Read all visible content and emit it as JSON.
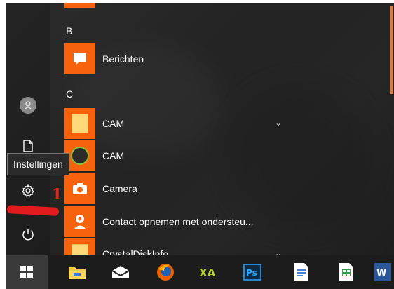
{
  "start_menu": {
    "tooltip": "Instellingen",
    "annotation_number": "1",
    "sections": [
      {
        "letter": "B"
      },
      {
        "letter": "C"
      }
    ],
    "apps": [
      {
        "label": "Berichten",
        "icon": "message-icon"
      },
      {
        "label": "CAM",
        "icon": "folder-icon",
        "expandable": true
      },
      {
        "label": "CAM",
        "icon": "cam-app-icon"
      },
      {
        "label": "Camera",
        "icon": "camera-icon"
      },
      {
        "label": "Contact opnemen met ondersteu...",
        "icon": "contact-support-icon"
      },
      {
        "label": "CrystalDiskInfo",
        "icon": "folder-icon",
        "expandable": true
      }
    ],
    "rail": [
      "user-avatar-icon",
      "document-icon",
      "settings-icon",
      "power-icon"
    ],
    "colors": {
      "tile": "#f7630c",
      "annotation": "#e0251b"
    }
  },
  "taskbar": {
    "items": [
      "windows-start-icon",
      "file-explorer-icon",
      "mail-icon",
      "firefox-icon",
      "xda-icon",
      "photoshop-icon",
      "docs-icon",
      "sheets-icon",
      "word-icon"
    ]
  }
}
